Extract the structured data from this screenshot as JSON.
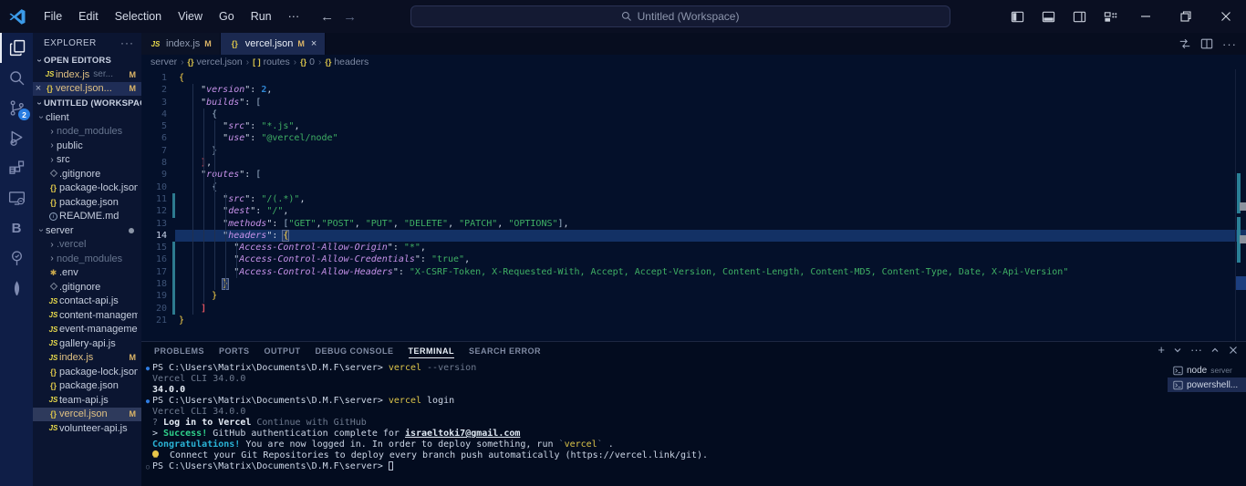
{
  "titlebar": {
    "logo": "vscode-logo",
    "menus": [
      "File",
      "Edit",
      "Selection",
      "View",
      "Go",
      "Run",
      "···"
    ],
    "nav_back": "←",
    "nav_forward": "→",
    "search_placeholder": "Untitled (Workspace)",
    "layout_icons": [
      "toggle-primary-sidebar",
      "toggle-panel",
      "toggle-secondary-sidebar",
      "customize-layout"
    ],
    "window_controls": [
      "minimize",
      "restore",
      "close"
    ]
  },
  "activitybar": {
    "items": [
      {
        "name": "explorer",
        "active": true
      },
      {
        "name": "search"
      },
      {
        "name": "source-control",
        "badge": "2"
      },
      {
        "name": "run-and-debug"
      },
      {
        "name": "extensions"
      },
      {
        "name": "remote-explorer"
      },
      {
        "name": "letter-b",
        "label": "B"
      },
      {
        "name": "testing-tree"
      },
      {
        "name": "mongodb"
      }
    ]
  },
  "sidebar": {
    "title": "EXPLORER",
    "more": "···",
    "open_editors_label": "OPEN EDITORS",
    "workspace_label": "UNTITLED (WORKSPACE)",
    "open_editors": [
      {
        "icon": "js",
        "label": "index.js",
        "detail": "ser...",
        "badge": "M",
        "modified": true
      },
      {
        "icon": "braces",
        "label": "vercel.json...",
        "badge": "M",
        "modified": true,
        "active": true,
        "close": true
      }
    ],
    "tree": [
      {
        "chev": "open",
        "label": "client",
        "indent": 1
      },
      {
        "chev": "closed",
        "label": "node_modules",
        "indent": 2,
        "dim": true
      },
      {
        "chev": "closed",
        "label": "public",
        "indent": 2
      },
      {
        "chev": "closed",
        "label": "src",
        "indent": 2
      },
      {
        "icon": "diamond",
        "label": ".gitignore",
        "indent": 2
      },
      {
        "icon": "braces",
        "label": "package-lock.json",
        "indent": 2
      },
      {
        "icon": "braces",
        "label": "package.json",
        "indent": 2
      },
      {
        "icon": "info",
        "label": "README.md",
        "indent": 2
      },
      {
        "chev": "open",
        "label": "server",
        "indent": 1,
        "dot": true
      },
      {
        "chev": "closed",
        "label": ".vercel",
        "indent": 2,
        "dim": true
      },
      {
        "chev": "closed",
        "label": "node_modules",
        "indent": 2,
        "dim": true
      },
      {
        "icon": "gear",
        "label": ".env",
        "indent": 2
      },
      {
        "icon": "diamond",
        "label": ".gitignore",
        "indent": 2
      },
      {
        "icon": "js",
        "label": "contact-api.js",
        "indent": 2
      },
      {
        "icon": "js",
        "label": "content-managem...",
        "indent": 2
      },
      {
        "icon": "js",
        "label": "event-manageme...",
        "indent": 2
      },
      {
        "icon": "js",
        "label": "gallery-api.js",
        "indent": 2
      },
      {
        "icon": "js",
        "label": "index.js",
        "indent": 2,
        "modified": true,
        "badge": "M"
      },
      {
        "icon": "braces",
        "label": "package-lock.json",
        "indent": 2
      },
      {
        "icon": "braces",
        "label": "package.json",
        "indent": 2
      },
      {
        "icon": "js",
        "label": "team-api.js",
        "indent": 2
      },
      {
        "icon": "braces",
        "label": "vercel.json",
        "indent": 2,
        "modified": true,
        "badge": "M",
        "selected": true
      },
      {
        "icon": "js",
        "label": "volunteer-api.js",
        "indent": 2
      }
    ]
  },
  "editor": {
    "tabs": [
      {
        "icon": "js",
        "label": "index.js",
        "badge": "M",
        "active": false
      },
      {
        "icon": "braces",
        "label": "vercel.json",
        "badge": "M",
        "active": true,
        "close": "×"
      }
    ],
    "actions": [
      "open-changes",
      "split-editor",
      "more-actions"
    ],
    "breadcrumb": [
      {
        "label": "server"
      },
      {
        "label": "vercel.json",
        "icon": "{}"
      },
      {
        "label": "routes",
        "icon": "[ ]"
      },
      {
        "label": "0",
        "icon": "{}"
      },
      {
        "label": "headers",
        "icon": "{}"
      }
    ],
    "current_line": 14,
    "modified_lines": [
      11,
      12,
      15,
      16,
      17,
      18,
      19,
      20
    ],
    "lines": [
      {
        "n": 1,
        "t": [
          [
            "g",
            "{"
          ]
        ]
      },
      {
        "n": 2,
        "t": [
          [
            "p",
            "    \""
          ],
          [
            "k",
            "version"
          ],
          [
            "p",
            "\": "
          ],
          [
            "n",
            "2"
          ],
          [
            "p",
            ","
          ]
        ]
      },
      {
        "n": 3,
        "t": [
          [
            "p",
            "    \""
          ],
          [
            "k",
            "builds"
          ],
          [
            "p",
            "\": "
          ],
          [
            "bl",
            "["
          ]
        ]
      },
      {
        "n": 4,
        "t": [
          [
            "p",
            "      "
          ],
          [
            "bl",
            "{"
          ]
        ]
      },
      {
        "n": 5,
        "t": [
          [
            "p",
            "        \""
          ],
          [
            "k",
            "src"
          ],
          [
            "p",
            "\": "
          ],
          [
            "s",
            "\"*.js\""
          ],
          [
            "p",
            ","
          ]
        ]
      },
      {
        "n": 6,
        "t": [
          [
            "p",
            "        \""
          ],
          [
            "k",
            "use"
          ],
          [
            "p",
            "\": "
          ],
          [
            "s",
            "\"@vercel/node\""
          ]
        ]
      },
      {
        "n": 7,
        "t": [
          [
            "p",
            "      "
          ],
          [
            "bl",
            "}"
          ]
        ]
      },
      {
        "n": 8,
        "t": [
          [
            "p",
            "    "
          ],
          [
            "r",
            "]"
          ],
          [
            "p",
            ","
          ]
        ]
      },
      {
        "n": 9,
        "t": [
          [
            "p",
            "    \""
          ],
          [
            "k",
            "routes"
          ],
          [
            "p",
            "\": "
          ],
          [
            "bl",
            "["
          ]
        ]
      },
      {
        "n": 10,
        "t": [
          [
            "p",
            "      "
          ],
          [
            "bl",
            "{"
          ]
        ]
      },
      {
        "n": 11,
        "t": [
          [
            "p",
            "        \""
          ],
          [
            "k",
            "src"
          ],
          [
            "p",
            "\": "
          ],
          [
            "s",
            "\"/(.*)\""
          ],
          [
            "p",
            ","
          ]
        ]
      },
      {
        "n": 12,
        "t": [
          [
            "p",
            "        \""
          ],
          [
            "k",
            "dest"
          ],
          [
            "p",
            "\": "
          ],
          [
            "s",
            "\"/\""
          ],
          [
            "p",
            ","
          ]
        ]
      },
      {
        "n": 13,
        "t": [
          [
            "p",
            "        \""
          ],
          [
            "k",
            "methods"
          ],
          [
            "p",
            "\": "
          ],
          [
            "bl",
            "["
          ],
          [
            "s",
            "\"GET\""
          ],
          [
            "p",
            ","
          ],
          [
            "s",
            "\"POST\""
          ],
          [
            "p",
            ", "
          ],
          [
            "s",
            "\"PUT\""
          ],
          [
            "p",
            ", "
          ],
          [
            "s",
            "\"DELETE\""
          ],
          [
            "p",
            ", "
          ],
          [
            "s",
            "\"PATCH\""
          ],
          [
            "p",
            ", "
          ],
          [
            "s",
            "\"OPTIONS\""
          ],
          [
            "bl",
            "]"
          ],
          [
            "p",
            ","
          ]
        ]
      },
      {
        "n": 14,
        "t": [
          [
            "p",
            "        \""
          ],
          [
            "k",
            "headers"
          ],
          [
            "p",
            "\": "
          ],
          [
            "m",
            "{"
          ]
        ]
      },
      {
        "n": 15,
        "t": [
          [
            "p",
            "          \""
          ],
          [
            "k",
            "Access-Control-Allow-Origin"
          ],
          [
            "p",
            "\": "
          ],
          [
            "s",
            "\"*\""
          ],
          [
            "p",
            ","
          ]
        ]
      },
      {
        "n": 16,
        "t": [
          [
            "p",
            "          \""
          ],
          [
            "k",
            "Access-Control-Allow-Credentials"
          ],
          [
            "p",
            "\": "
          ],
          [
            "s",
            "\"true\""
          ],
          [
            "p",
            ","
          ]
        ]
      },
      {
        "n": 17,
        "t": [
          [
            "p",
            "          \""
          ],
          [
            "k",
            "Access-Control-Allow-Headers"
          ],
          [
            "p",
            "\": "
          ],
          [
            "s",
            "\"X-CSRF-Token, X-Requested-With, Accept, Accept-Version, Content-Length, Content-MD5, Content-Type, Date, X-Api-Version\""
          ]
        ]
      },
      {
        "n": 18,
        "t": [
          [
            "p",
            "        "
          ],
          [
            "m",
            "}"
          ]
        ]
      },
      {
        "n": 19,
        "t": [
          [
            "p",
            "      "
          ],
          [
            "g",
            "}"
          ]
        ]
      },
      {
        "n": 20,
        "t": [
          [
            "p",
            "    "
          ],
          [
            "r",
            "]"
          ]
        ]
      },
      {
        "n": 21,
        "t": [
          [
            "g",
            "}"
          ]
        ]
      }
    ]
  },
  "panel": {
    "tabs": [
      "PROBLEMS",
      "PORTS",
      "OUTPUT",
      "DEBUG CONSOLE",
      "TERMINAL",
      "SEARCH ERROR"
    ],
    "active_tab": "TERMINAL",
    "actions": [
      "new-terminal",
      "launch-profile",
      "more",
      "maximize-panel",
      "close-panel"
    ],
    "terminal_lines": [
      {
        "bullet": "run",
        "t": [
          [
            "wh",
            "PS C:\\Users\\Matrix\\Documents\\D.M.F\\server> "
          ],
          [
            "yl",
            "vercel"
          ],
          [
            "dim",
            " --version"
          ]
        ]
      },
      {
        "t": [
          [
            "dim",
            "Vercel CLI 34.0.0"
          ]
        ]
      },
      {
        "t": [
          [
            "bw",
            "34.0.0"
          ]
        ]
      },
      {
        "bullet": "run",
        "t": [
          [
            "wh",
            "PS C:\\Users\\Matrix\\Documents\\D.M.F\\server> "
          ],
          [
            "yl",
            "vercel"
          ],
          [
            "wh",
            " login"
          ]
        ]
      },
      {
        "t": [
          [
            "dim",
            "Vercel CLI 34.0.0"
          ]
        ]
      },
      {
        "t": [
          [
            "dim",
            "? "
          ],
          [
            "bw",
            "Log in to Vercel"
          ],
          [
            "dim",
            " Continue with GitHub"
          ]
        ]
      },
      {
        "t": [
          [
            "wh",
            "> "
          ],
          [
            "gr",
            "Success!"
          ],
          [
            "wh",
            " GitHub authentication complete for "
          ],
          [
            "un",
            "israeltoki7@gmail.com"
          ]
        ]
      },
      {
        "t": [
          [
            "cy",
            "Congratulations!"
          ],
          [
            "wh",
            " You are now logged in. In order to deploy something, run "
          ],
          [
            "dim",
            "`"
          ],
          [
            "yl",
            "vercel"
          ],
          [
            "dim",
            "`"
          ],
          [
            "wh",
            " ."
          ]
        ]
      },
      {
        "t": [
          [
            "bulb",
            ""
          ],
          [
            "wh",
            "  Connect your Git Repositories to deploy every branch push automatically (https://vercel.link/git)."
          ]
        ]
      },
      {
        "bullet": "idle",
        "t": [
          [
            "wh",
            "PS C:\\Users\\Matrix\\Documents\\D.M.F\\server> "
          ],
          [
            "cur",
            ""
          ]
        ]
      }
    ],
    "terminals": [
      {
        "icon": "terminal",
        "label": "node",
        "detail": "server"
      },
      {
        "icon": "terminal",
        "label": "powershell...",
        "selected": true
      }
    ]
  }
}
